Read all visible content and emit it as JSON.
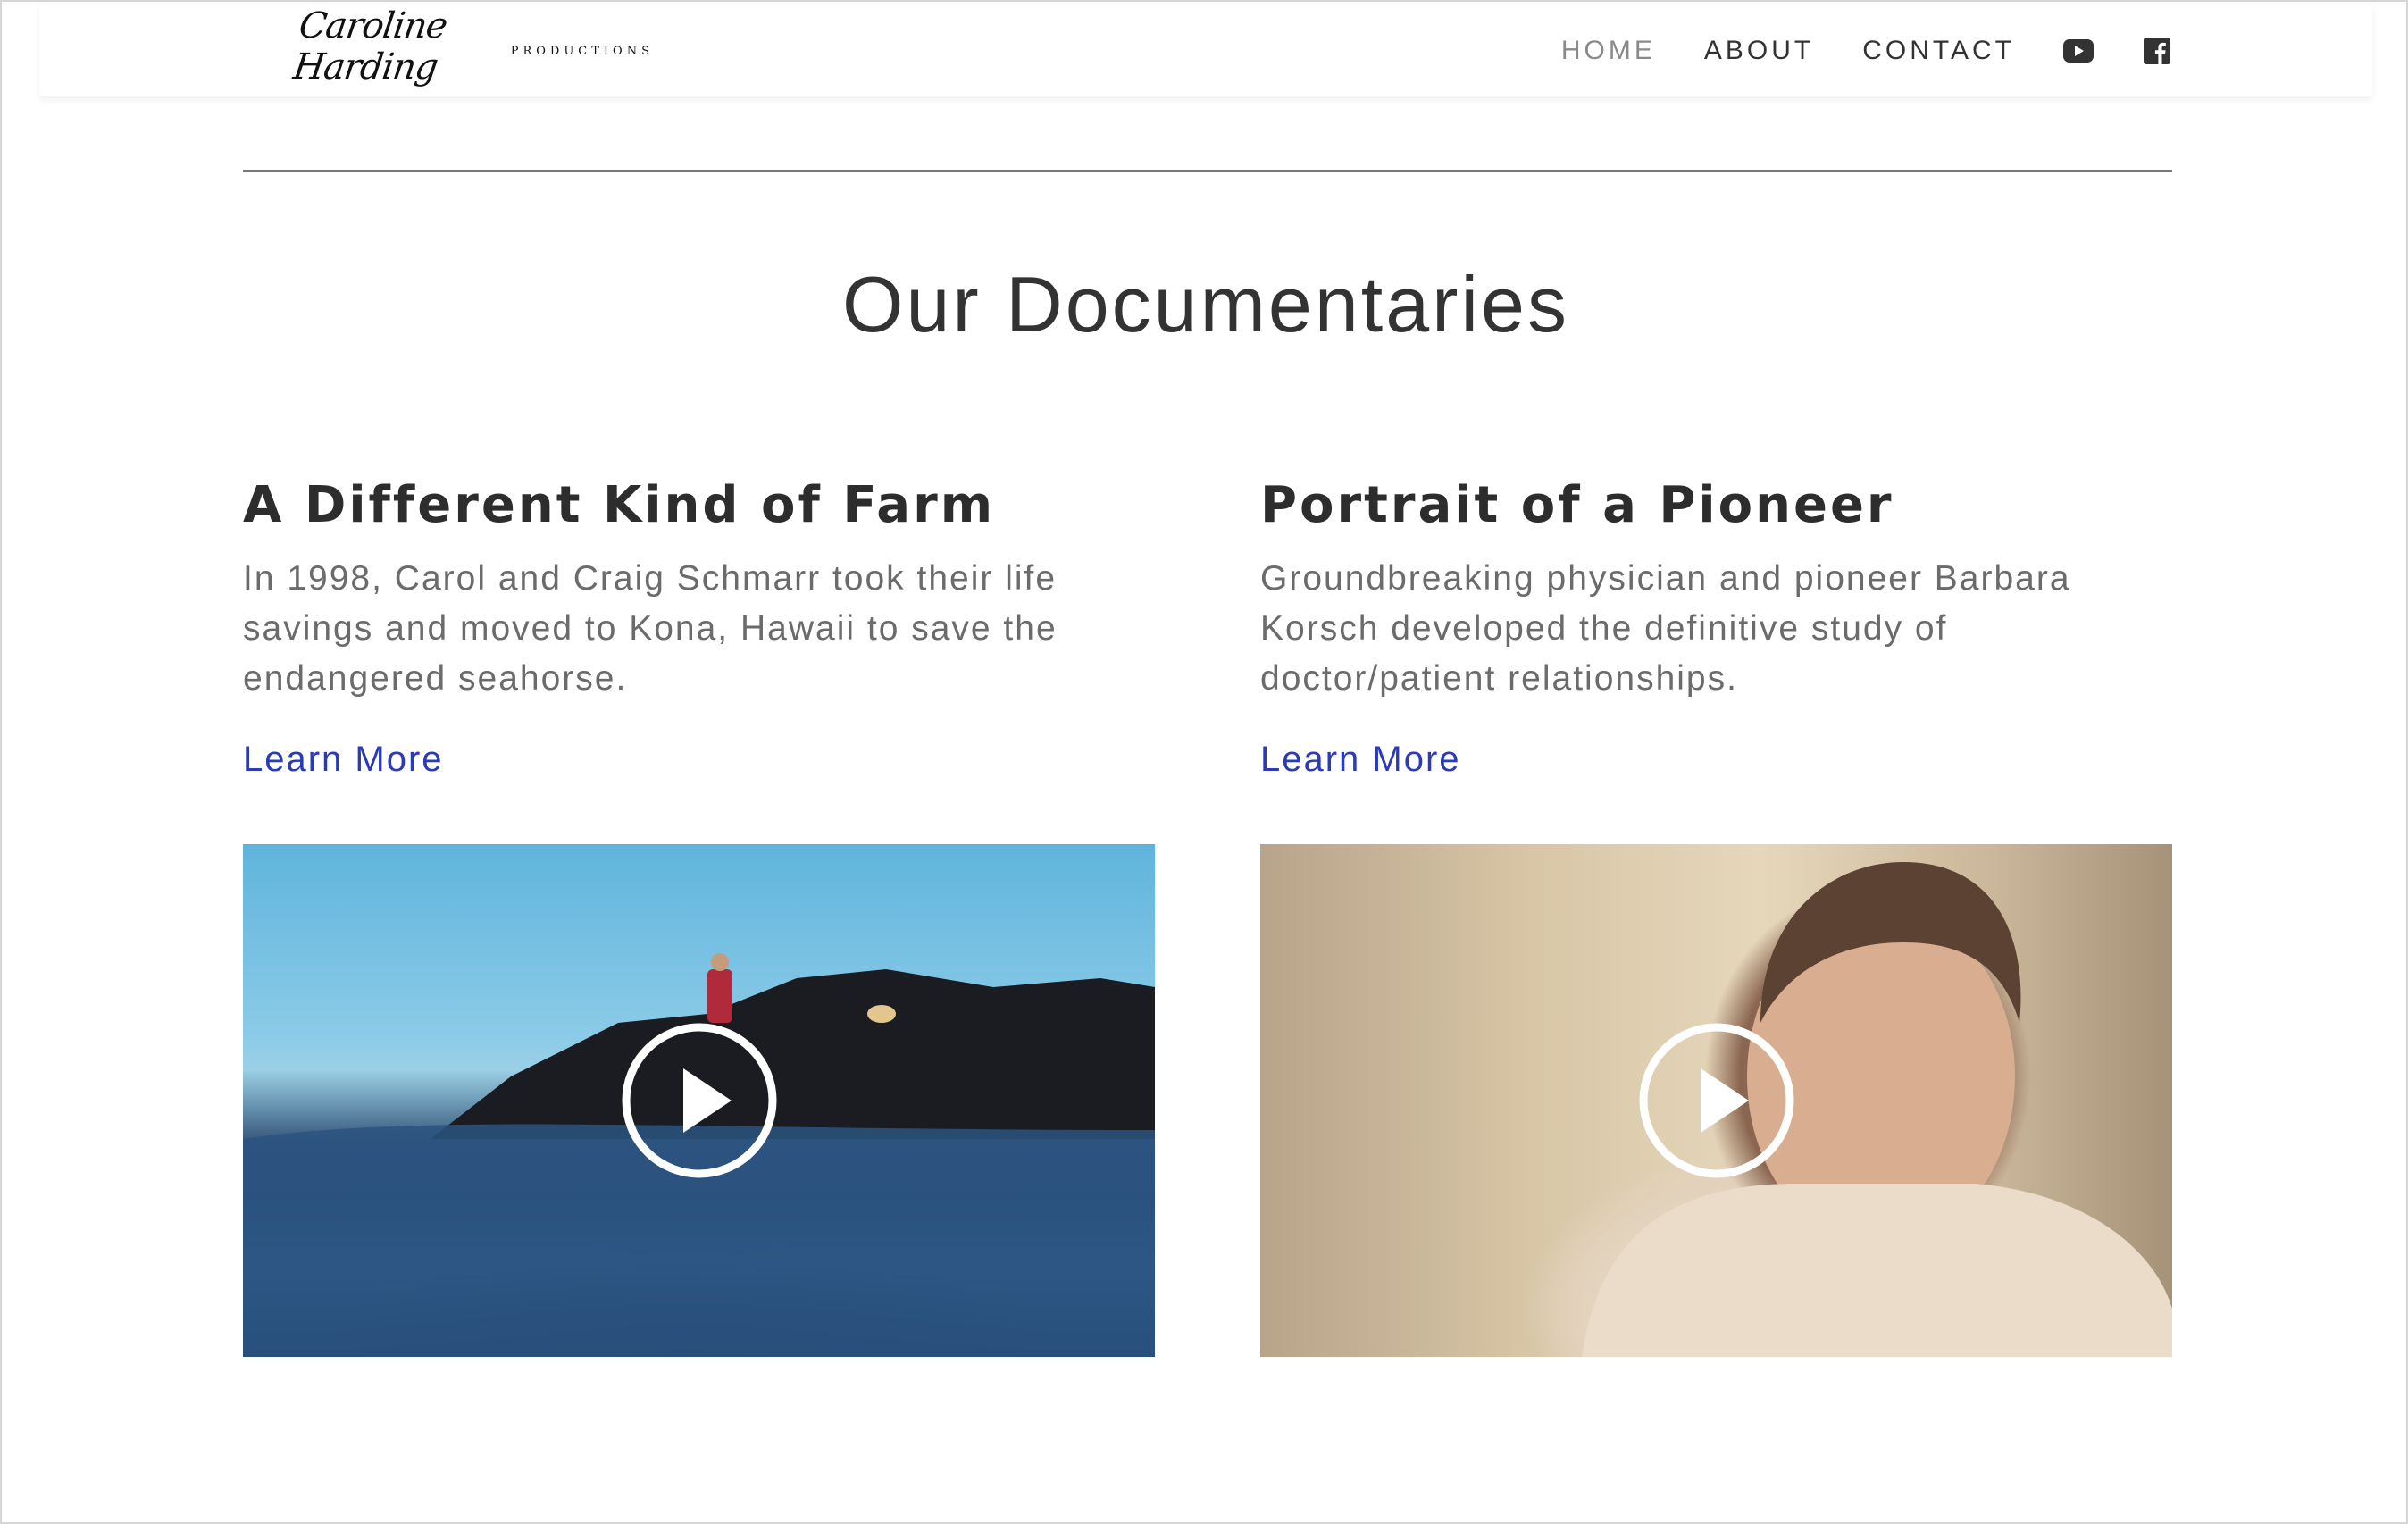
{
  "brand": {
    "name": "Caroline Harding",
    "sub": "PRODUCTIONS"
  },
  "nav": {
    "items": [
      {
        "label": "HOME",
        "active": true
      },
      {
        "label": "ABOUT",
        "active": false
      },
      {
        "label": "CONTACT",
        "active": false
      }
    ],
    "icons": [
      "youtube-icon",
      "facebook-icon"
    ]
  },
  "main": {
    "title": "Our Documentaries",
    "docs": [
      {
        "title": "A Different Kind of Farm",
        "description": "In 1998, Carol and Craig Schmarr took their life savings and moved to Kona, Hawaii to save the endangered seahorse.",
        "link_label": "Learn More"
      },
      {
        "title": "Portrait of a Pioneer",
        "description": "Groundbreaking physician and pioneer Barbara Korsch developed the definitive study of doctor/patient relationships.",
        "link_label": "Learn More"
      }
    ]
  },
  "colors": {
    "link": "#2b3bb8",
    "text": "#333333",
    "muted": "#6b6b6b",
    "nav_active": "#8a8a8a"
  }
}
